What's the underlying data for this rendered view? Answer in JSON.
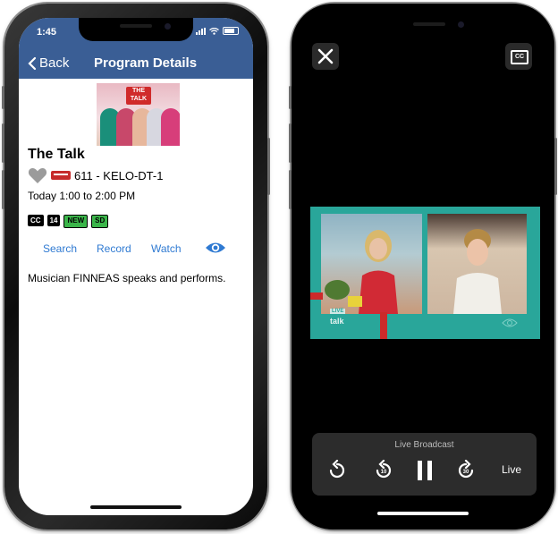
{
  "left_phone": {
    "status": {
      "time": "1:45"
    },
    "navbar": {
      "back_label": "Back",
      "title": "Program Details"
    },
    "program": {
      "thumbnail_logo": "THE TALK",
      "title": "The Talk",
      "channel": "611 - KELO-DT-1",
      "airtime": "Today 1:00 to 2:00 PM",
      "badges": [
        "CC",
        "14",
        "NEW",
        "SD"
      ],
      "description": "Musician FINNEAS speaks and performs."
    },
    "actions": {
      "search": "Search",
      "record": "Record",
      "watch": "Watch",
      "icon": "eye-icon"
    },
    "colors": {
      "navbar": "#3a5e95",
      "link": "#2f7ad2",
      "badge_green": "#3bb54a"
    }
  },
  "right_phone": {
    "overlay": {
      "live_tag": "LIVE",
      "show_logo": "talk",
      "live_label": "Live Broadcast",
      "live_button": "Live"
    },
    "icons": [
      "close-icon",
      "closed-captions-icon",
      "replay-icon",
      "skip-back-10-icon",
      "pause-icon",
      "skip-forward-30-icon"
    ],
    "colors": {
      "video_bg": "#29a69a",
      "controls_bg": "#2c2c2c"
    }
  }
}
